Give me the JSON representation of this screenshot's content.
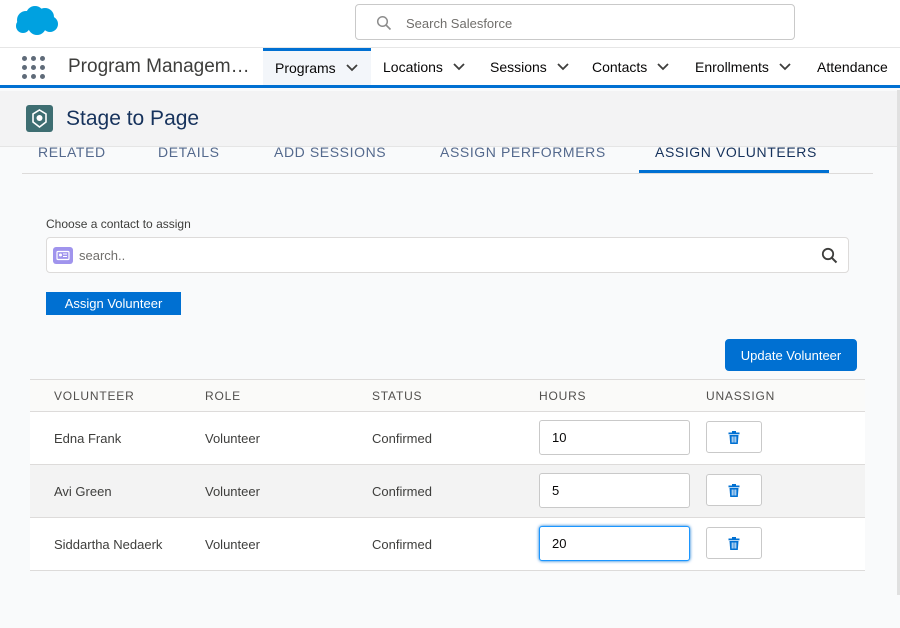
{
  "global_header": {
    "search_placeholder": "Search Salesforce"
  },
  "app_nav": {
    "app_name": "Program Managem…",
    "tabs": [
      {
        "label": "Programs",
        "active": true
      },
      {
        "label": "Locations"
      },
      {
        "label": "Sessions"
      },
      {
        "label": "Contacts"
      },
      {
        "label": "Enrollments"
      },
      {
        "label": "Attendance"
      }
    ]
  },
  "record": {
    "title": "Stage to Page"
  },
  "record_tabs": [
    {
      "label": "RELATED"
    },
    {
      "label": "DETAILS"
    },
    {
      "label": "ADD SESSIONS"
    },
    {
      "label": "ASSIGN PERFORMERS"
    },
    {
      "label": "ASSIGN VOLUNTEERS",
      "active": true
    }
  ],
  "assign_form": {
    "label": "Choose a contact to assign",
    "search_placeholder": "search..",
    "assign_button": "Assign Volunteer",
    "update_button": "Update Volunteer"
  },
  "table": {
    "columns": [
      "VOLUNTEER",
      "ROLE",
      "STATUS",
      "HOURS",
      "UNASSIGN"
    ],
    "rows": [
      {
        "volunteer": "Edna Frank",
        "role": "Volunteer",
        "status": "Confirmed",
        "hours": "10"
      },
      {
        "volunteer": "Avi Green",
        "role": "Volunteer",
        "status": "Confirmed",
        "hours": "5"
      },
      {
        "volunteer": "Siddartha Nedaerk",
        "role": "Volunteer",
        "status": "Confirmed",
        "hours": "20"
      }
    ]
  },
  "colors": {
    "brand": "#0070d2",
    "salesforce_cloud": "#00a1e0",
    "contact_icon": "#a094ed",
    "object_icon": "#3e6e72"
  },
  "icons": [
    "salesforce-logo",
    "search-icon",
    "app-launcher-icon",
    "chevron-down-icon",
    "contact-icon",
    "trash-icon"
  ]
}
